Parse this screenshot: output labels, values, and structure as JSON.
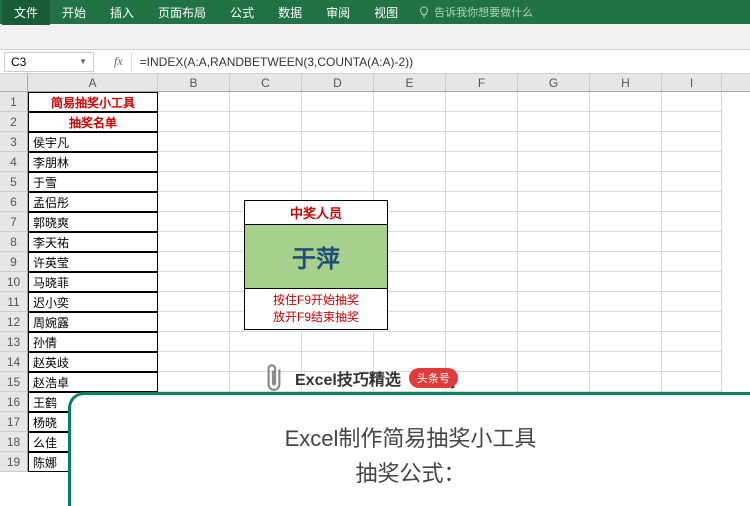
{
  "ribbon": {
    "tabs": [
      "文件",
      "开始",
      "插入",
      "页面布局",
      "公式",
      "数据",
      "审阅",
      "视图"
    ],
    "tell_me": "告诉我你想要做什么"
  },
  "namebox": {
    "ref": "C3"
  },
  "formula_bar": {
    "value": "=INDEX(A:A,RANDBETWEEN(3,COUNTA(A:A)-2))"
  },
  "columns": [
    "A",
    "B",
    "C",
    "D",
    "E",
    "F",
    "G",
    "H",
    "I"
  ],
  "sheet": {
    "title": "简易抽奖小工具",
    "subtitle": "抽奖名单",
    "names": [
      "侯宇凡",
      "李朋林",
      "于雪",
      "孟侣彤",
      "郭晓爽",
      "李天祐",
      "许英莹",
      "马晓菲",
      "迟小奕",
      "周婉露",
      "孙倩",
      "赵英歧",
      "赵浩卓",
      "王鹤",
      "杨晓",
      "么佳",
      "陈娜"
    ]
  },
  "winner": {
    "header": "中奖人员",
    "name": "于萍",
    "tip1": "按住F9开始抽奖",
    "tip2": "放开F9结束抽奖"
  },
  "overlay": {
    "brand": "Excel技巧精选",
    "badge": "头条号",
    "line1": "Excel制作简易抽奖小工具",
    "line2": "抽奖公式："
  }
}
